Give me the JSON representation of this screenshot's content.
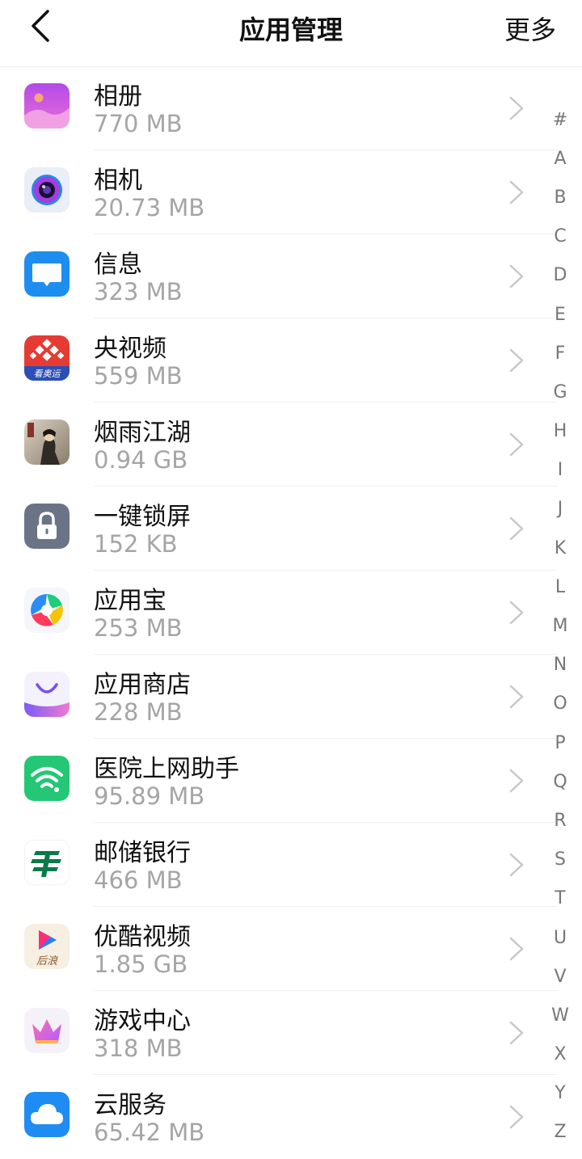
{
  "header": {
    "title": "应用管理",
    "more": "更多"
  },
  "apps": [
    {
      "name": "相册",
      "size": "770 MB",
      "icon": "album-icon"
    },
    {
      "name": "相机",
      "size": "20.73 MB",
      "icon": "camera-icon"
    },
    {
      "name": "信息",
      "size": "323 MB",
      "icon": "message-icon"
    },
    {
      "name": "央视频",
      "size": "559 MB",
      "icon": "cctv-video-icon",
      "icon_text": "看奥运"
    },
    {
      "name": "烟雨江湖",
      "size": "0.94 GB",
      "icon": "game-yanyu-icon"
    },
    {
      "name": "一键锁屏",
      "size": "152 KB",
      "icon": "lock-icon"
    },
    {
      "name": "应用宝",
      "size": "253 MB",
      "icon": "app-treasure-icon"
    },
    {
      "name": "应用商店",
      "size": "228 MB",
      "icon": "app-store-icon"
    },
    {
      "name": "医院上网助手",
      "size": "95.89 MB",
      "icon": "wifi-icon"
    },
    {
      "name": "邮储银行",
      "size": "466 MB",
      "icon": "postal-bank-icon"
    },
    {
      "name": "优酷视频",
      "size": "1.85 GB",
      "icon": "youku-icon",
      "icon_text": "后浪"
    },
    {
      "name": "游戏中心",
      "size": "318 MB",
      "icon": "game-center-icon"
    },
    {
      "name": "云服务",
      "size": "65.42 MB",
      "icon": "cloud-icon"
    }
  ],
  "alphabet": [
    "#",
    "A",
    "B",
    "C",
    "D",
    "E",
    "F",
    "G",
    "H",
    "I",
    "J",
    "K",
    "L",
    "M",
    "N",
    "O",
    "P",
    "Q",
    "R",
    "S",
    "T",
    "U",
    "V",
    "W",
    "X",
    "Y",
    "Z"
  ],
  "colors": {
    "size_text": "#a5a5a5",
    "message": "#1e8df0",
    "wifi": "#24c775",
    "cloud": "#1f8cf3",
    "lock": "#6b7386"
  }
}
